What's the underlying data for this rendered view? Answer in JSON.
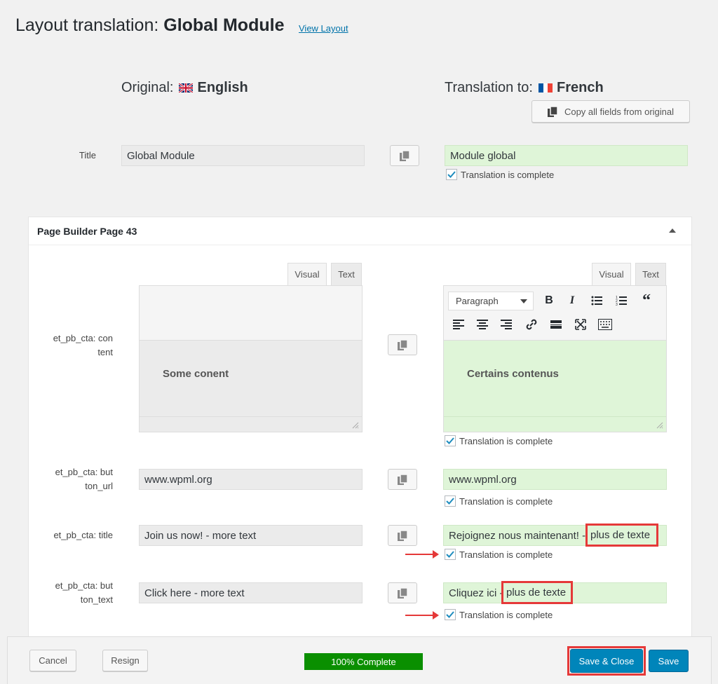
{
  "header": {
    "title_prefix": "Layout translation: ",
    "title_name": "Global Module",
    "view_layout": "View Layout"
  },
  "original": {
    "label": "Original:",
    "language": "English"
  },
  "translation": {
    "label": "Translation to:",
    "language": "French"
  },
  "copy_all_label": "Copy all fields from original",
  "title_field": {
    "label": "Title",
    "original": "Global Module",
    "translation": "Module global",
    "complete_label": "Translation is complete"
  },
  "panel": {
    "title": "Page Builder Page 43",
    "tabs": {
      "visual": "Visual",
      "text": "Text"
    },
    "toolbar": {
      "format_select": "Paragraph"
    }
  },
  "fields": [
    {
      "label_line1": "et_pb_cta: con",
      "label_line2": "tent",
      "original": "Some conent",
      "translation": "Certains contenus",
      "complete_label": "Translation is complete"
    },
    {
      "label_line1": "et_pb_cta: but",
      "label_line2": "ton_url",
      "original": "www.wpml.org",
      "translation": "www.wpml.org",
      "complete_label": "Translation is complete"
    },
    {
      "label_line1": "et_pb_cta: title",
      "label_line2": "",
      "original": "Join us now! - more text",
      "translation_pre": "Rejoignez nous maintenant! - ",
      "translation_highlight": "plus de texte",
      "complete_label": "Translation is complete"
    },
    {
      "label_line1": "et_pb_cta: but",
      "label_line2": "ton_text",
      "original": "Click here - more text",
      "translation_pre": "Cliquez ici - ",
      "translation_highlight": "plus de texte",
      "complete_label": "Translation is complete"
    }
  ],
  "footer": {
    "cancel": "Cancel",
    "resign": "Resign",
    "progress": "100% Complete",
    "progress_value": 1.0,
    "save_close": "Save & Close",
    "save": "Save"
  },
  "colors": {
    "accent": "#0085ba",
    "link": "#0073aa",
    "progress": "#0a8f00",
    "highlight": "#e53939",
    "translation_bg": "#dff5d8"
  },
  "icons": [
    "copy-icon",
    "bold-icon",
    "italic-icon",
    "bullet-list-icon",
    "numbered-list-icon",
    "blockquote-icon",
    "align-left-icon",
    "align-center-icon",
    "align-right-icon",
    "link-icon",
    "read-more-icon",
    "fullscreen-icon",
    "toolbar-toggle-icon",
    "uk-flag-icon",
    "france-flag-icon",
    "checkmark-icon"
  ]
}
